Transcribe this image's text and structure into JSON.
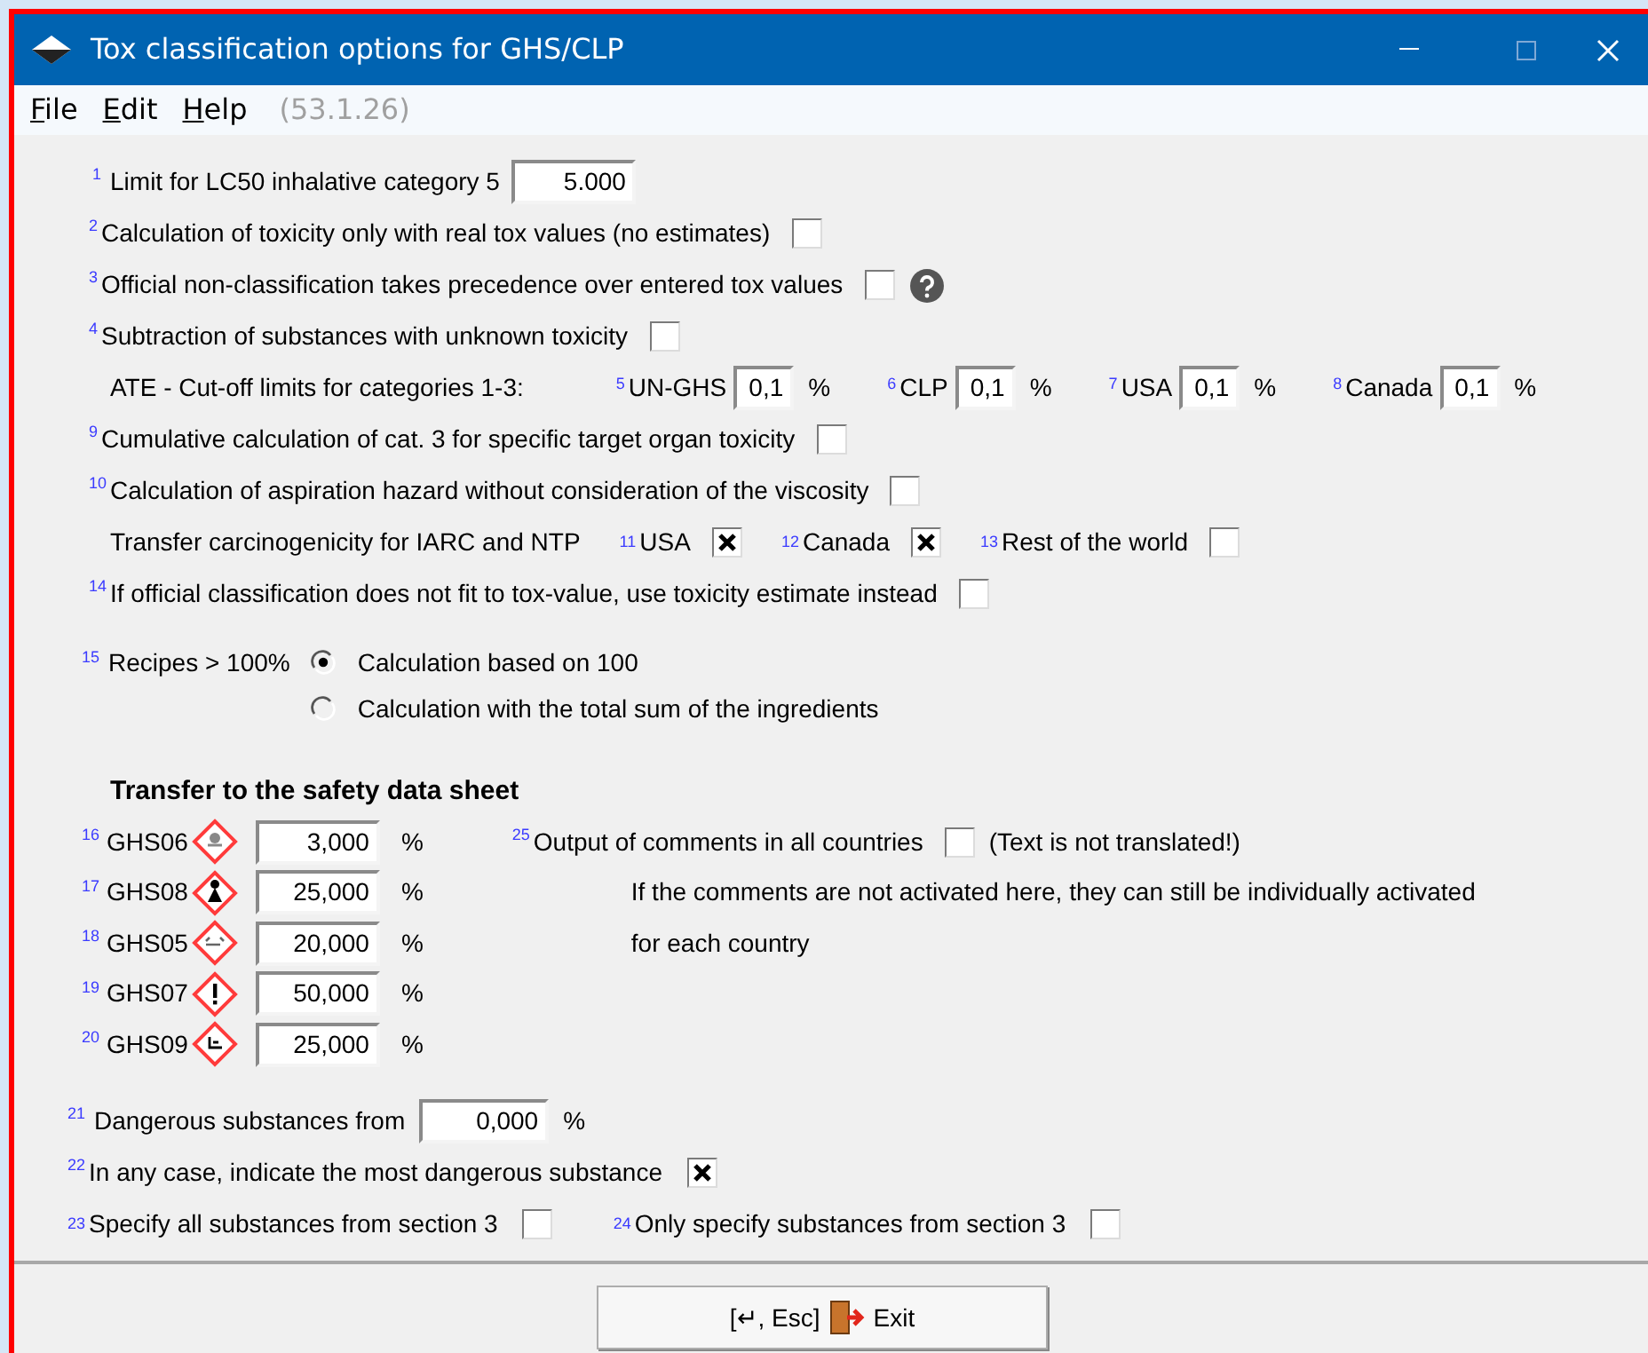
{
  "window": {
    "title": "Tox classification options for GHS/CLP"
  },
  "menu": [
    {
      "label": "File"
    },
    {
      "label": "Edit"
    },
    {
      "label": "Help"
    }
  ],
  "version": "(53.1.26)",
  "options": [
    {
      "kind": "input",
      "num": "1",
      "label": "Limit for LC50 inhalative category 5",
      "value": "5.000"
    },
    {
      "kind": "checkbox",
      "num": "2",
      "label": "Calculation of toxicity only with real tox values (no estimates)",
      "checked": false
    },
    {
      "kind": "checkbox",
      "num": "3",
      "label": "Official non-classification takes precedence over entered tox values",
      "checked": false,
      "help": true
    },
    {
      "kind": "checkbox",
      "num": "4",
      "label": "Subtraction of substances with unknown toxicity",
      "checked": false
    },
    {
      "kind": "limits",
      "label": "ATE - Cut-off limits for categories 1-3:",
      "fields": [
        {
          "num": "5",
          "label": "UN-GHS",
          "value": "0,1",
          "unit": "%"
        },
        {
          "num": "6",
          "label": "CLP",
          "value": "0,1",
          "unit": "%"
        },
        {
          "num": "7",
          "label": "USA",
          "value": "0,1",
          "unit": "%"
        },
        {
          "num": "8",
          "label": "Canada",
          "value": "0,1",
          "unit": "%"
        }
      ]
    },
    {
      "kind": "checkbox",
      "num": "9",
      "label": "Cumulative calculation of cat. 3 for specific target organ toxicity",
      "checked": false
    },
    {
      "kind": "checkbox",
      "num": "10",
      "label": "Calculation of aspiration hazard without consideration of the viscosity",
      "checked": false
    },
    {
      "kind": "checks",
      "label": "Transfer carcinogenicity for IARC and NTP",
      "items": [
        {
          "num": "11",
          "label": "USA",
          "checked": true
        },
        {
          "num": "12",
          "label": "Canada",
          "checked": true
        },
        {
          "num": "13",
          "label": "Rest of the world",
          "checked": false
        }
      ]
    },
    {
      "kind": "checkbox",
      "num": "14",
      "label": "If official classification does not fit to tox-value, use toxicity estimate instead",
      "checked": false
    }
  ],
  "recipes": {
    "num": "15",
    "label": "Recipes > 100%",
    "options": [
      {
        "label": "Calculation based on 100",
        "selected": true
      },
      {
        "label": "Calculation with the total sum of the ingredients",
        "selected": false
      }
    ]
  },
  "sds": {
    "heading": "Transfer to the safety data sheet",
    "pictograms": [
      {
        "num": "16",
        "label": "GHS06",
        "value": "3,000",
        "unit": "%"
      },
      {
        "num": "17",
        "label": "GHS08",
        "value": "25,000",
        "unit": "%"
      },
      {
        "num": "18",
        "label": "GHS05",
        "value": "20,000",
        "unit": "%"
      },
      {
        "num": "19",
        "label": "GHS07",
        "value": "50,000",
        "unit": "%"
      },
      {
        "num": "20",
        "label": "GHS09",
        "value": "25,000",
        "unit": "%"
      }
    ],
    "comments": {
      "num": "25",
      "label": "Output of comments in all countries",
      "checked": false,
      "note": "(Text is not translated!)",
      "info": [
        "If the comments are not activated here, they can still be individually activated",
        "for each country"
      ]
    }
  },
  "dangerous": {
    "num": "21",
    "label": "Dangerous substances from",
    "value": "0,000",
    "unit": "%"
  },
  "most_dangerous": {
    "num": "22",
    "label": "In any case, indicate the most dangerous substance",
    "checked": true
  },
  "section3": [
    {
      "num": "23",
      "label": "Specify all substances from section 3",
      "checked": false
    },
    {
      "num": "24",
      "label": "Only specify substances from section 3",
      "checked": false
    }
  ],
  "exit_button": {
    "shortcut": "[↵, Esc]",
    "label": "Exit"
  }
}
